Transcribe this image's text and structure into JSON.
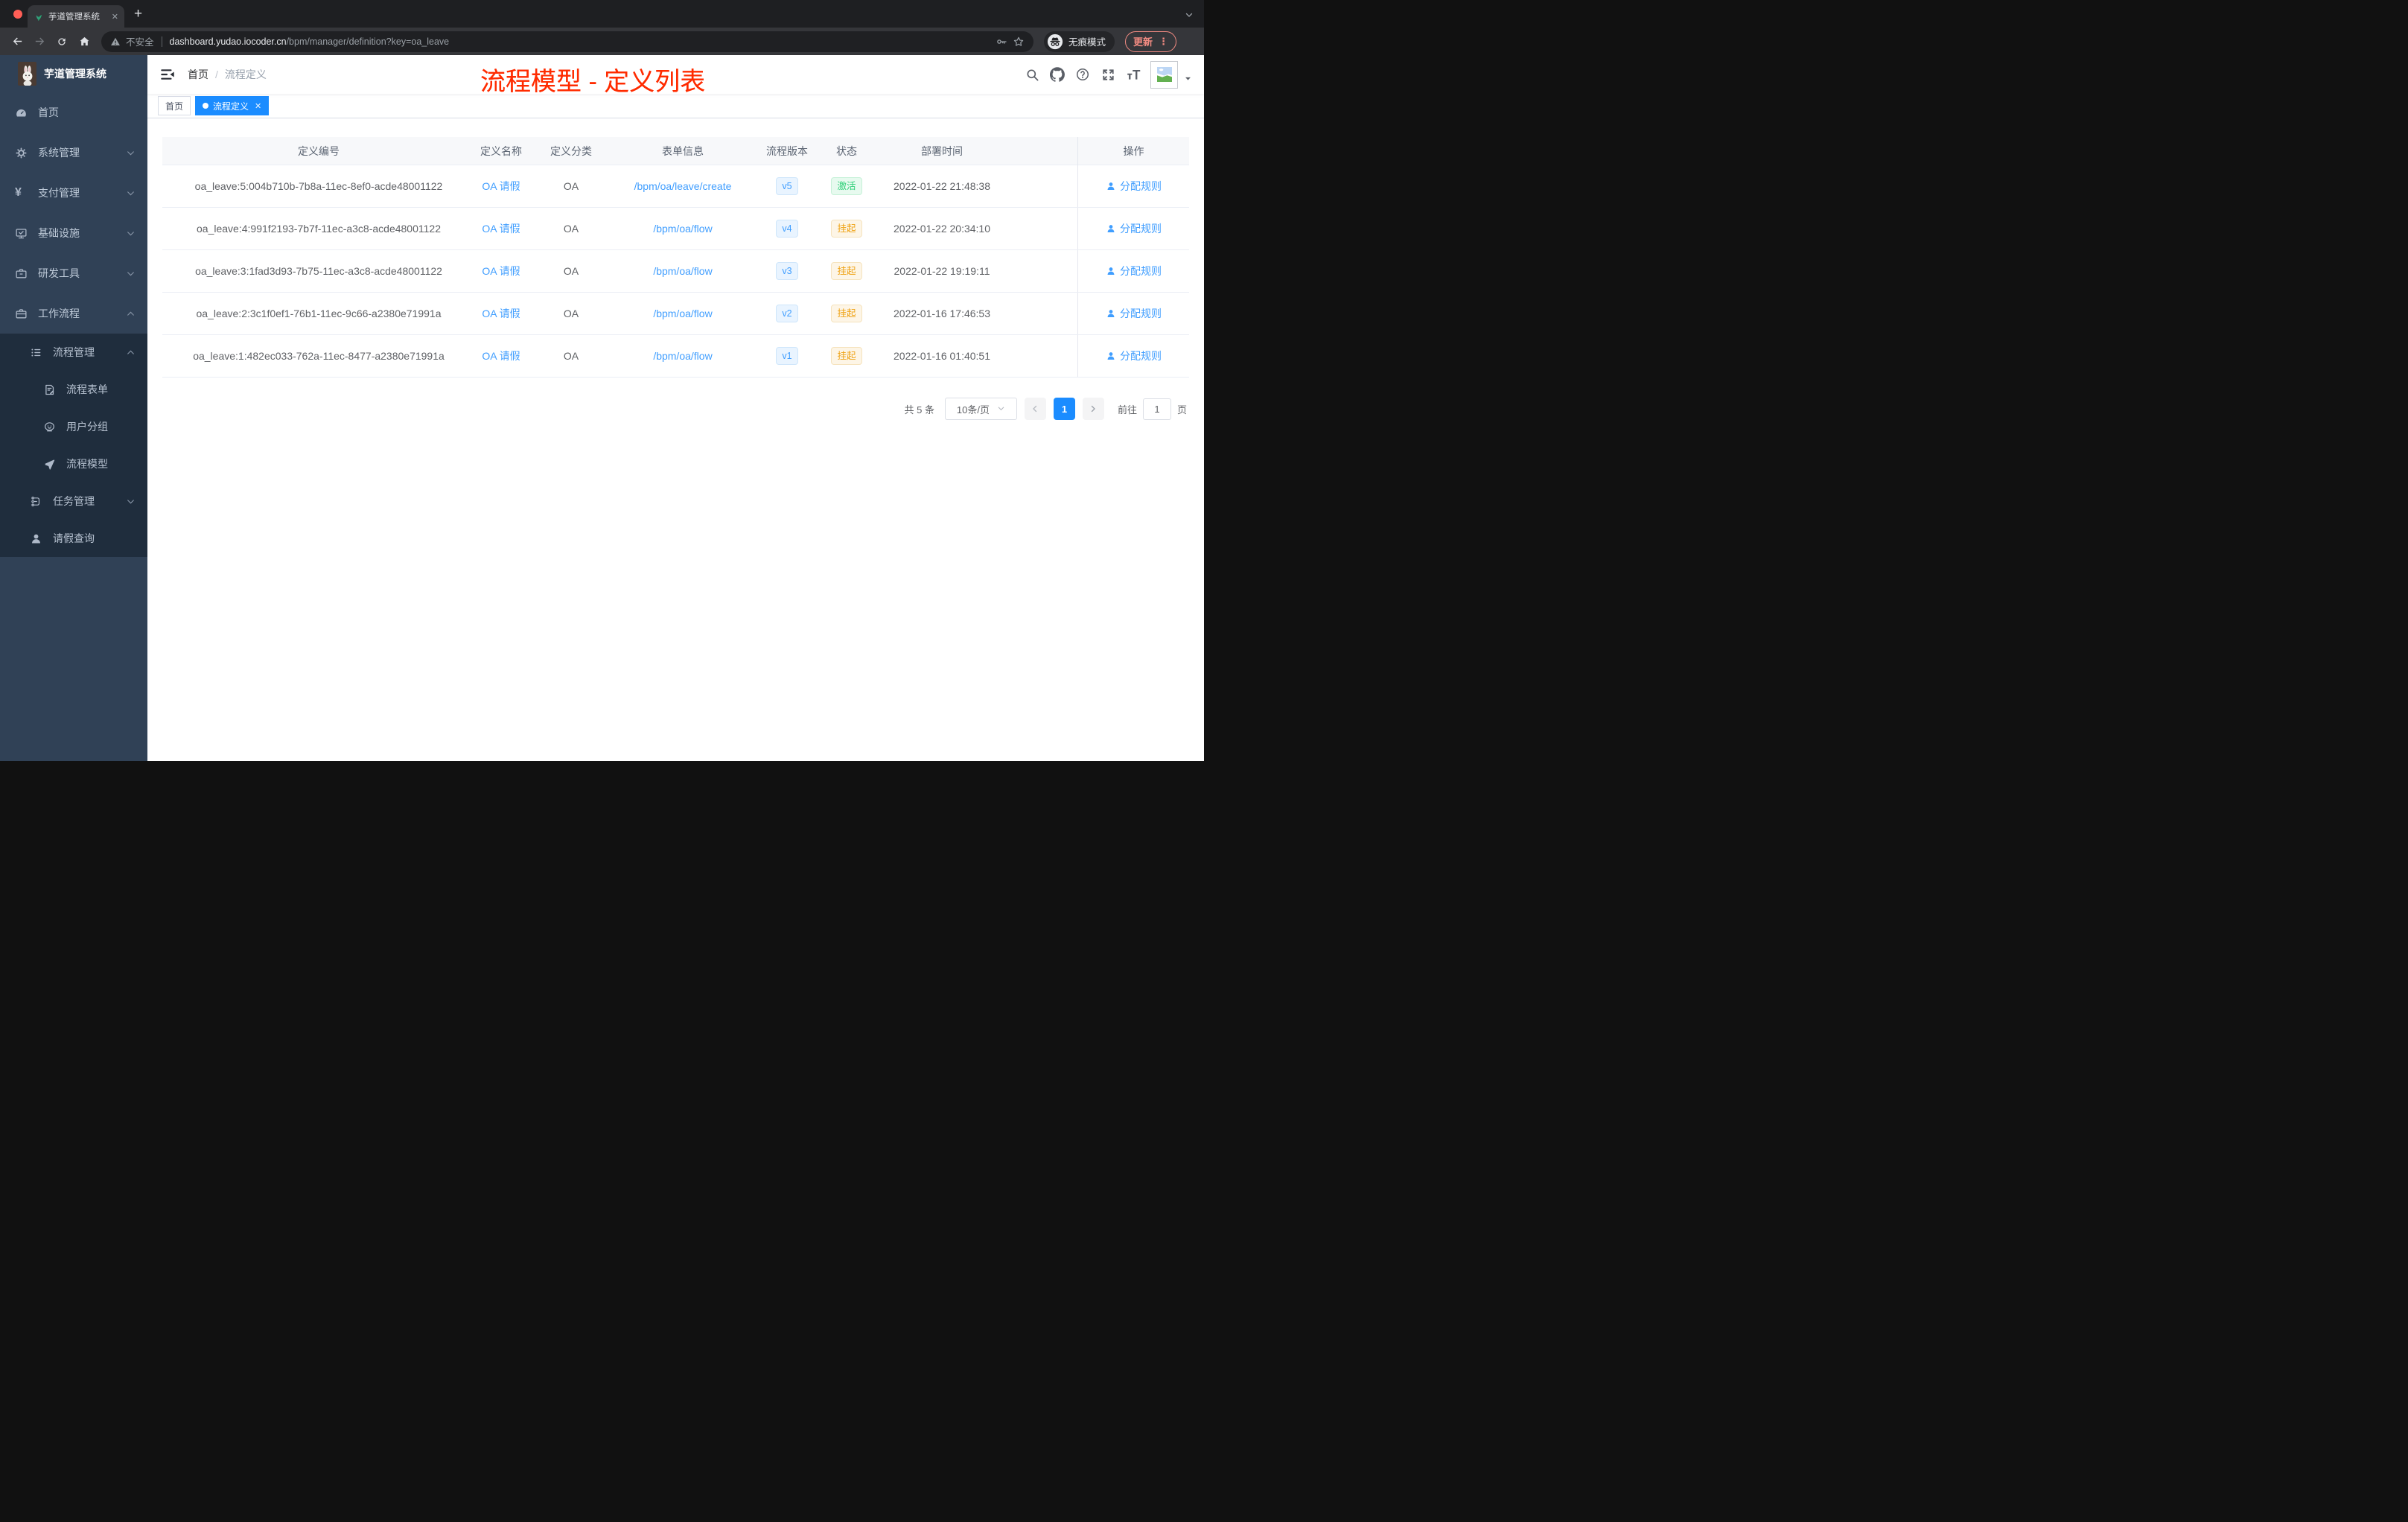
{
  "colors": {
    "accent": "#1b8cff",
    "annotation_red": "#ff2b00",
    "link_blue": "#409eff",
    "status_active_green": "#2fd078",
    "status_suspend_orange": "#efa213",
    "sidebar_bg": "#304156",
    "submenu_bg": "#1f2d3d",
    "chrome_dark": "#1e1f22",
    "chrome_toolbar": "#35363a"
  },
  "browser": {
    "tab_title": "芋道管理系统",
    "security_label": "不安全",
    "url_host": "dashboard.yudao.iocoder.cn",
    "url_path": "/bpm/manager/definition?key=oa_leave",
    "incognito_label": "无痕模式",
    "update_label": "更新"
  },
  "sidebar": {
    "logo_title": "芋道管理系统",
    "items": [
      {
        "label": "首页",
        "icon": "dashboard-icon",
        "level": 0,
        "dark": false,
        "chevron": ""
      },
      {
        "label": "系统管理",
        "icon": "gear-icon",
        "level": 0,
        "dark": false,
        "chevron": "down"
      },
      {
        "label": "支付管理",
        "icon": "yen-icon",
        "level": 0,
        "dark": false,
        "chevron": "down"
      },
      {
        "label": "基础设施",
        "icon": "monitor-icon",
        "level": 0,
        "dark": false,
        "chevron": "down"
      },
      {
        "label": "研发工具",
        "icon": "toolbox-icon",
        "level": 0,
        "dark": false,
        "chevron": "down"
      },
      {
        "label": "工作流程",
        "icon": "briefcase-icon",
        "level": 0,
        "dark": false,
        "chevron": "up"
      },
      {
        "label": "流程管理",
        "icon": "list-icon",
        "level": 1,
        "dark": true,
        "chevron": "up"
      },
      {
        "label": "流程表单",
        "icon": "form-icon",
        "level": 2,
        "dark": true,
        "chevron": ""
      },
      {
        "label": "用户分组",
        "icon": "group-icon",
        "level": 2,
        "dark": true,
        "chevron": ""
      },
      {
        "label": "流程模型",
        "icon": "plane-icon",
        "level": 2,
        "dark": true,
        "chevron": ""
      },
      {
        "label": "任务管理",
        "icon": "tree-icon",
        "level": 1,
        "dark": true,
        "chevron": "down"
      },
      {
        "label": "请假查询",
        "icon": "user-icon",
        "level": 1,
        "dark": true,
        "chevron": ""
      }
    ]
  },
  "header": {
    "breadcrumb": [
      "首页",
      "流程定义"
    ],
    "annotation": "流程模型 - 定义列表"
  },
  "tags": [
    {
      "label": "首页",
      "active": false,
      "closable": false
    },
    {
      "label": "流程定义",
      "active": true,
      "closable": true
    }
  ],
  "table": {
    "columns": [
      "定义编号",
      "定义名称",
      "定义分类",
      "表单信息",
      "流程版本",
      "状态",
      "部署时间",
      "操作"
    ],
    "action_label": "分配规则",
    "rows": [
      {
        "id": "oa_leave:5:004b710b-7b8a-11ec-8ef0-acde48001122",
        "name": "OA 请假",
        "category": "OA",
        "form": "/bpm/oa/leave/create",
        "version": "v5",
        "status": "激活",
        "status_type": "success",
        "time": "2022-01-22 21:48:38"
      },
      {
        "id": "oa_leave:4:991f2193-7b7f-11ec-a3c8-acde48001122",
        "name": "OA 请假",
        "category": "OA",
        "form": "/bpm/oa/flow",
        "version": "v4",
        "status": "挂起",
        "status_type": "warning",
        "time": "2022-01-22 20:34:10"
      },
      {
        "id": "oa_leave:3:1fad3d93-7b75-11ec-a3c8-acde48001122",
        "name": "OA 请假",
        "category": "OA",
        "form": "/bpm/oa/flow",
        "version": "v3",
        "status": "挂起",
        "status_type": "warning",
        "time": "2022-01-22 19:19:11"
      },
      {
        "id": "oa_leave:2:3c1f0ef1-76b1-11ec-9c66-a2380e71991a",
        "name": "OA 请假",
        "category": "OA",
        "form": "/bpm/oa/flow",
        "version": "v2",
        "status": "挂起",
        "status_type": "warning",
        "time": "2022-01-16 17:46:53"
      },
      {
        "id": "oa_leave:1:482ec033-762a-11ec-8477-a2380e71991a",
        "name": "OA 请假",
        "category": "OA",
        "form": "/bpm/oa/flow",
        "version": "v1",
        "status": "挂起",
        "status_type": "warning",
        "time": "2022-01-16 01:40:51"
      }
    ]
  },
  "pagination": {
    "total": "共 5 条",
    "page_size": "10条/页",
    "current_page": "1",
    "goto_prefix": "前往",
    "goto_value": "1",
    "goto_suffix": "页"
  }
}
